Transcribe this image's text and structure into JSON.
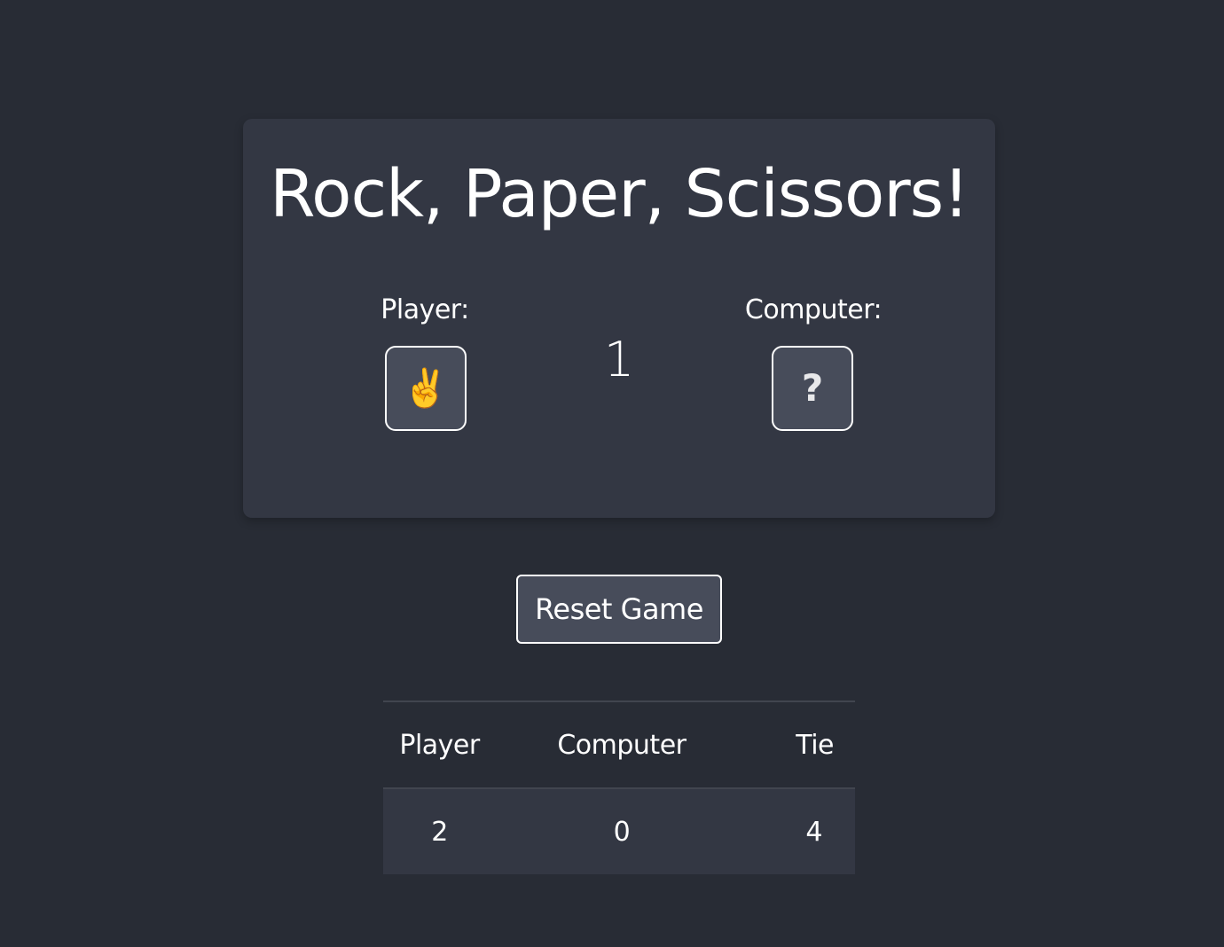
{
  "game": {
    "title": "Rock, Paper, Scissors!",
    "player_label": "Player:",
    "computer_label": "Computer:",
    "player_choice": "✌️",
    "player_choice_icon": "victory-hand-icon",
    "computer_choice": "?",
    "computer_choice_icon": "question-mark-icon",
    "round": "1"
  },
  "controls": {
    "reset_label": "Reset Game"
  },
  "scoreboard": {
    "headers": [
      "Player",
      "Computer",
      "Tie"
    ],
    "values": [
      "2",
      "0",
      "4"
    ]
  },
  "colors": {
    "background": "#282c35",
    "card": "#333743",
    "box": "#474c5a",
    "text": "#ffffff"
  }
}
